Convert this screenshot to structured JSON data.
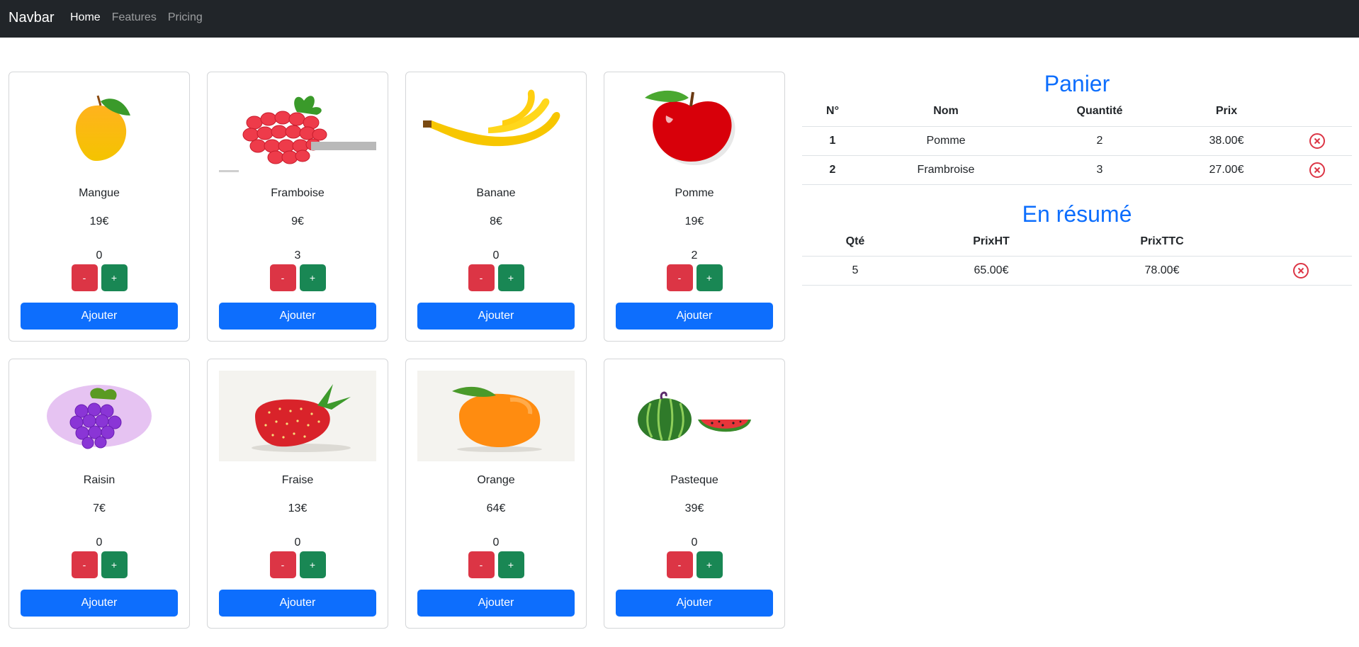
{
  "navbar": {
    "brand": "Navbar",
    "links": [
      "Home",
      "Features",
      "Pricing"
    ]
  },
  "products": [
    {
      "name": "Mangue",
      "price": "19€",
      "qty": "0",
      "icon": "mango-icon"
    },
    {
      "name": "Framboise",
      "price": "9€",
      "qty": "3",
      "icon": "raspberry-icon"
    },
    {
      "name": "Banane",
      "price": "8€",
      "qty": "0",
      "icon": "banana-icon"
    },
    {
      "name": "Pomme",
      "price": "19€",
      "qty": "2",
      "icon": "apple-icon"
    },
    {
      "name": "Raisin",
      "price": "7€",
      "qty": "0",
      "icon": "grape-icon"
    },
    {
      "name": "Fraise",
      "price": "13€",
      "qty": "0",
      "icon": "strawberry-icon"
    },
    {
      "name": "Orange",
      "price": "64€",
      "qty": "0",
      "icon": "orange-icon"
    },
    {
      "name": "Pasteque",
      "price": "39€",
      "qty": "0",
      "icon": "watermelon-icon"
    }
  ],
  "buttons": {
    "minus": "-",
    "plus": "+",
    "add": "Ajouter"
  },
  "cart": {
    "title": "Panier",
    "headers": [
      "N°",
      "Nom",
      "Quantité",
      "Prix"
    ],
    "rows": [
      {
        "num": "1",
        "name": "Pomme",
        "qty": "2",
        "price": "38.00€"
      },
      {
        "num": "2",
        "name": "Frambroise",
        "qty": "3",
        "price": "27.00€"
      }
    ]
  },
  "summary": {
    "title": "En résumé",
    "headers": [
      "Qté",
      "PrixHT",
      "PrixTTC"
    ],
    "row": {
      "qty": "5",
      "ht": "65.00€",
      "ttc": "78.00€"
    }
  },
  "colors": {
    "navbar_bg": "#212529",
    "primary": "#0d6efd",
    "danger": "#dc3545",
    "success": "#198754"
  }
}
